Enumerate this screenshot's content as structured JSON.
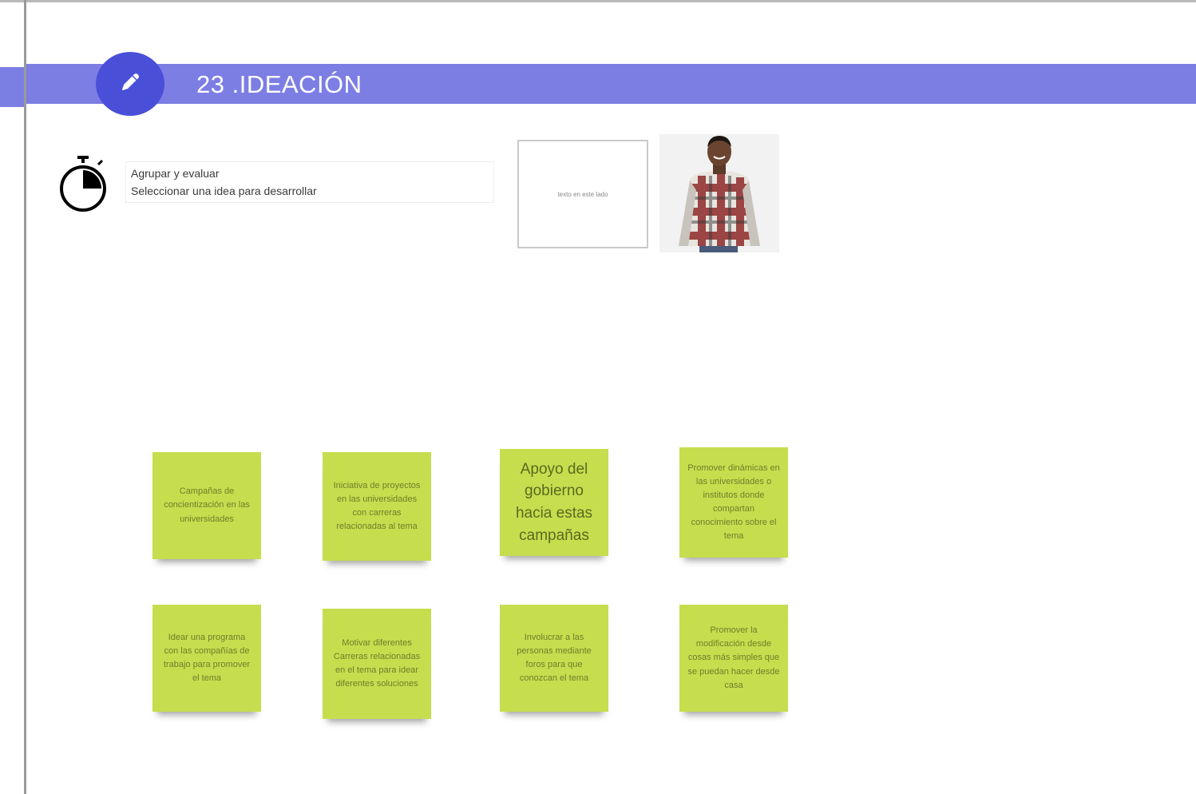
{
  "section": {
    "number_title": "23 .IDEACIÓN",
    "banner_color": "#7c7ee4",
    "icon_circle_color": "#4a4fd8",
    "icon": "pen-icon"
  },
  "instructions": {
    "icon": "stopwatch-icon",
    "line1": "Agrupar y evaluar",
    "line2": "Seleccionar una idea para desarrollar"
  },
  "card": {
    "text": "texto en este lado"
  },
  "persona": {
    "image": "person-photo"
  },
  "sticky_color": "#c6dd4e",
  "stickies": [
    "Campañas de concientización en las universidades",
    "Iniciativa de proyectos en las universidades con carreras relacionadas al tema",
    "Apoyo del gobierno hacia estas campañas",
    "Promover dinámicas en las universidades o institutos donde compartan conocimiento sobre el tema",
    "Idear una programa con las compañías de trabajo para promover el tema",
    "Motivar diferentes Carreras relacionadas en el tema para idear diferentes soluciones",
    "Involucrar a las personas mediante foros para que conozcan el tema",
    "Promover la modificación desde cosas más simples que se puedan hacer desde casa"
  ]
}
